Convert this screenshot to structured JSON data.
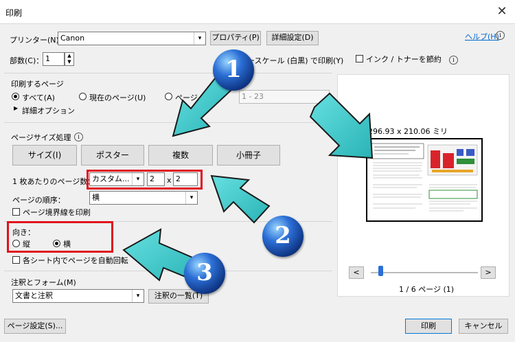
{
  "window": {
    "title": "印刷",
    "close_glyph": "✕"
  },
  "printer": {
    "label": "プリンター(N)：",
    "value": "Canon",
    "properties_btn": "プロパティ(P)",
    "advanced_btn": "詳細設定(D)",
    "help_link": "ヘルプ(H)",
    "copies_label": "部数(C)：",
    "copies_value": "1",
    "grayscale_label": "グレースケール (白黒) で印刷(Y)",
    "save_ink_label": "インク / トナーを節約"
  },
  "pages": {
    "heading": "印刷するページ",
    "all_label": "すべて(A)",
    "current_label": "現在のページ(U)",
    "pages_label": "ページ",
    "range_value": "1 - 23",
    "more_options": "詳細オプション"
  },
  "sizing": {
    "heading": "ページサイズ処理",
    "size_btn": "サイズ(I)",
    "poster_btn": "ポスター",
    "multiple_btn": "複数",
    "booklet_btn": "小冊子",
    "pages_per_sheet_label": "1 枚あたりのページ数：",
    "pages_per_sheet_value": "カスタム...",
    "cols": "2",
    "x": "x",
    "rows": "2",
    "order_label": "ページの順序：",
    "order_value": "横",
    "border_label": "ページ境界線を印刷"
  },
  "orientation": {
    "heading": "向き：",
    "portrait": "縦",
    "landscape": "横",
    "auto_rotate": "各シート内でページを自動回転"
  },
  "comments": {
    "heading": "注釈とフォーム(M)",
    "value": "文書と注釈",
    "summary_btn": "注釈の一覧(T)"
  },
  "preview": {
    "dimensions": "296.93 x 210.06 ミリ",
    "prev_btn": "<",
    "next_btn": ">",
    "page_indicator": "1 / 6 ページ (1)"
  },
  "footer": {
    "page_setup_btn": "ページ設定(S)...",
    "print_btn": "印刷",
    "cancel_btn": "キャンセル"
  },
  "annotations": {
    "badge1": "1",
    "badge2": "2",
    "badge3": "3"
  },
  "colors": {
    "accent_red": "#e0111d",
    "arrow_teal": "#3cc8c8",
    "link_blue": "#0066cc"
  },
  "icons": [
    "close-icon",
    "info-icon",
    "dropdown-arrow-icon",
    "spinner-icon",
    "expand-triangle-icon",
    "arrow-annotation-icon"
  ]
}
